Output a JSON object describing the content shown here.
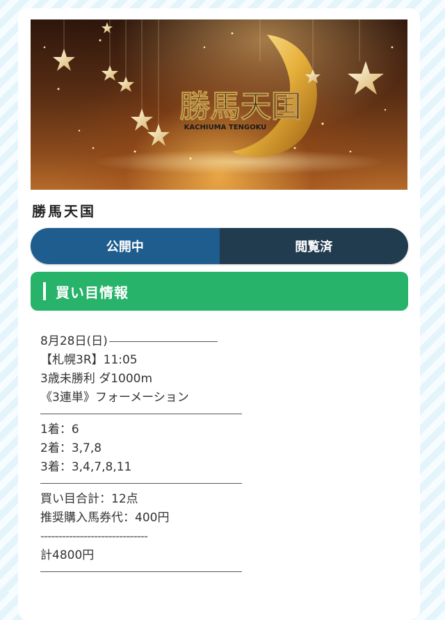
{
  "banner": {
    "logo_text": "勝馬天国",
    "logo_subtext": "KACHIUMA TENGOKU"
  },
  "site": {
    "title": "勝馬天国"
  },
  "tabs": [
    {
      "label": "公開中",
      "state": "active",
      "color": "#1f5d8f"
    },
    {
      "label": "閲覧済",
      "state": "inactive",
      "color": "#223c4f"
    }
  ],
  "section": {
    "title": "買い目情報",
    "color": "#27b36a"
  },
  "info": {
    "date": "8月28日(日)",
    "race": "【札幌3R】11:05",
    "condition": "3歳未勝利 ダ1000m",
    "bet_type": "《3連単》フォーメーション",
    "first": "1着：6",
    "second": "2着：3,7,8",
    "third": "3着：3,4,7,8,11",
    "total_points": "買い目合計：12点",
    "recommended_amount": "推奨購入馬券代：400円",
    "dashes": "------------------------------",
    "total_cost": "計4800円"
  }
}
